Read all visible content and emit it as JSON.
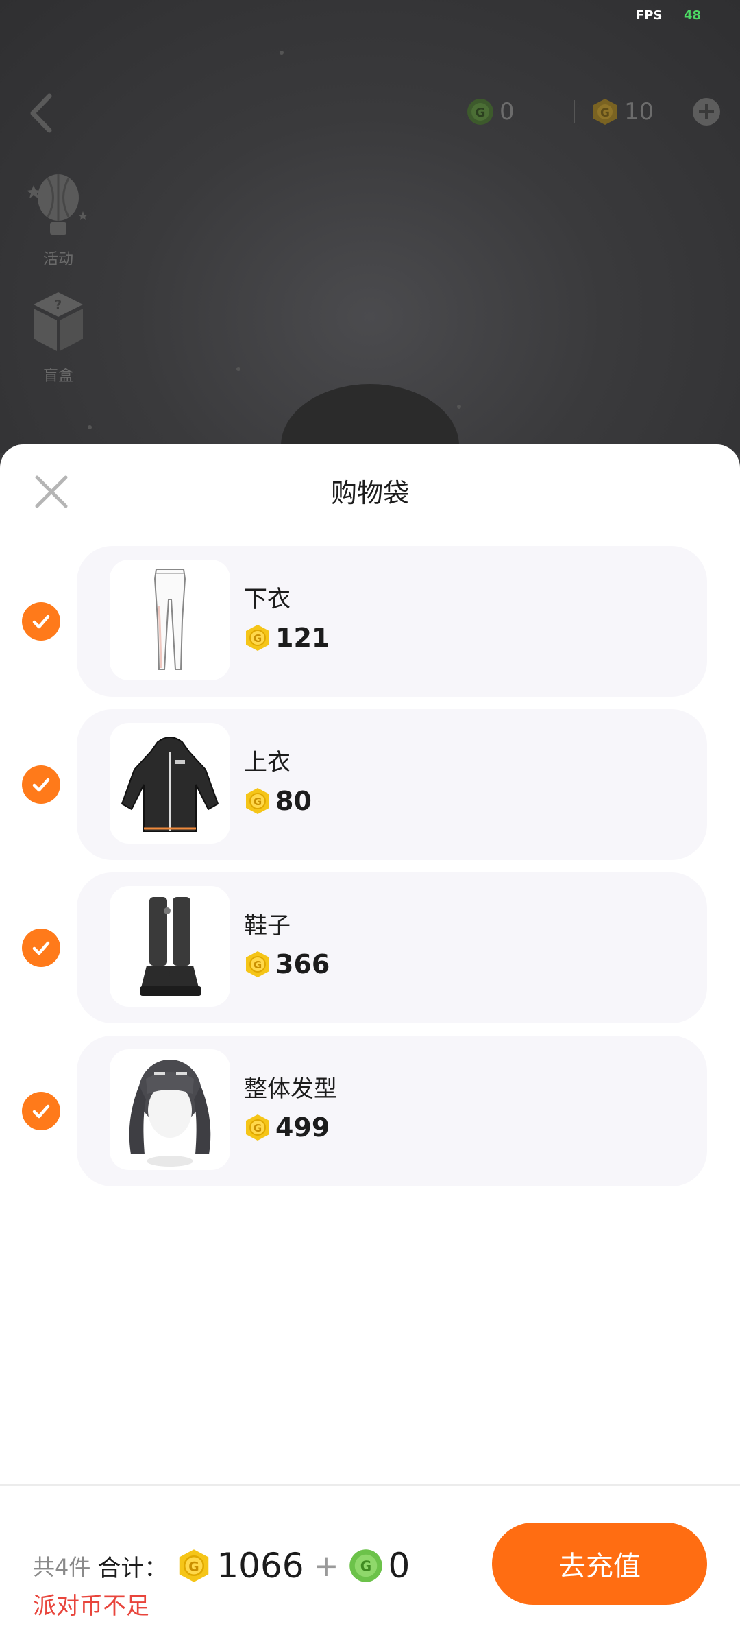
{
  "status": {
    "fps_label": "FPS",
    "fps_value": "48"
  },
  "header": {
    "party_coins": "0",
    "gold_coins": "10"
  },
  "side_menu": [
    {
      "label": "活动",
      "icon": "balloon-icon"
    },
    {
      "label": "盲盒",
      "icon": "mystery-box-icon"
    }
  ],
  "sheet": {
    "title": "购物袋",
    "items": [
      {
        "name": "下衣",
        "price": "121",
        "checked": true,
        "icon": "leggings-icon"
      },
      {
        "name": "上衣",
        "price": "80",
        "checked": true,
        "icon": "hoodie-dress-icon"
      },
      {
        "name": "鞋子",
        "price": "366",
        "checked": true,
        "icon": "boots-icon"
      },
      {
        "name": "整体发型",
        "price": "499",
        "checked": true,
        "icon": "twin-tails-hair-icon"
      }
    ]
  },
  "footer": {
    "count_text": "共4件",
    "total_label": "合计：",
    "gold_total": "1066",
    "plus": "+",
    "party_total": "0",
    "warning": "派对币不足",
    "recharge_label": "去充值"
  },
  "colors": {
    "accent": "#ff6d12",
    "check": "#ff7a1a",
    "warning": "#e8453c",
    "gold_coin": "#f5c518",
    "party_coin": "#6cc24a"
  }
}
